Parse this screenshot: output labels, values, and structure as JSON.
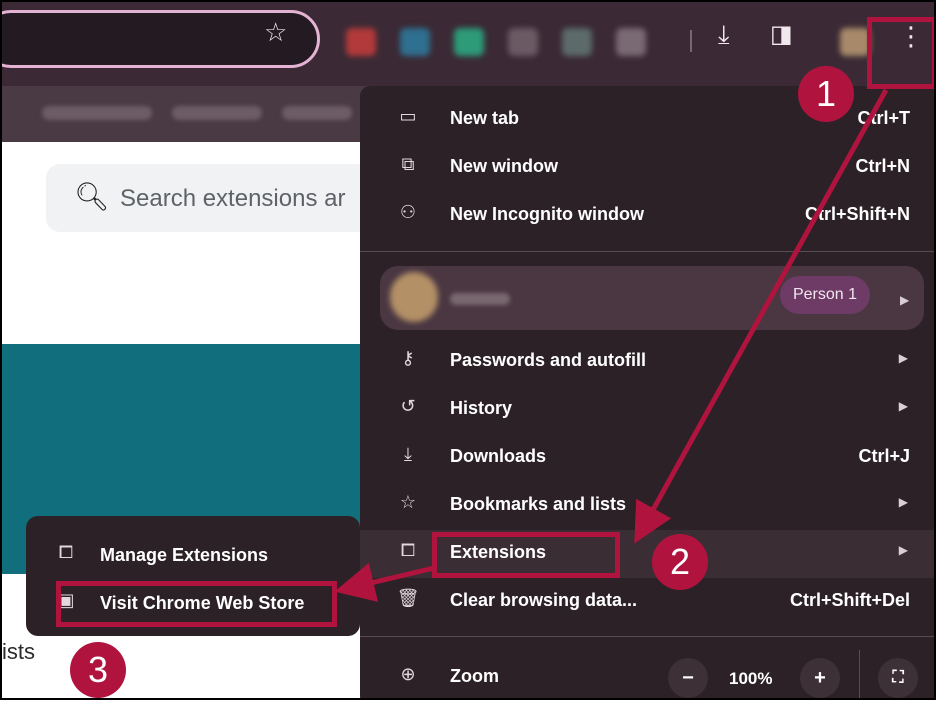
{
  "browser": {
    "toolbar_icons": [
      "star-icon",
      "download-icon",
      "side-panel-icon",
      "kebab-menu-icon"
    ]
  },
  "page": {
    "search": {
      "placeholder": "Search extensions ar"
    },
    "partial_text": "ists"
  },
  "menu": {
    "items": [
      {
        "icon": "new-tab-icon",
        "label": "New tab",
        "shortcut": "Ctrl+T"
      },
      {
        "icon": "new-window-icon",
        "label": "New window",
        "shortcut": "Ctrl+N"
      },
      {
        "icon": "incognito-icon",
        "label": "New Incognito window",
        "shortcut": "Ctrl+Shift+N"
      }
    ],
    "profile": {
      "badge": "Person 1"
    },
    "items2": [
      {
        "icon": "key-icon",
        "label": "Passwords and autofill",
        "shortcut": ""
      },
      {
        "icon": "history-icon",
        "label": "History",
        "shortcut": ""
      },
      {
        "icon": "download-icon",
        "label": "Downloads",
        "shortcut": "Ctrl+J"
      },
      {
        "icon": "star-icon",
        "label": "Bookmarks and lists",
        "shortcut": ""
      },
      {
        "icon": "puzzle-icon",
        "label": "Extensions",
        "shortcut": ""
      },
      {
        "icon": "trash-icon",
        "label": "Clear browsing data...",
        "shortcut": "Ctrl+Shift+Del"
      }
    ],
    "zoom": {
      "label": "Zoom",
      "value": "100%",
      "minus": "−",
      "plus": "+"
    }
  },
  "submenu": {
    "items": [
      {
        "icon": "puzzle-icon",
        "label": "Manage Extensions"
      },
      {
        "icon": "store-icon",
        "label": "Visit Chrome Web Store"
      }
    ]
  },
  "annotations": {
    "steps": [
      "1",
      "2",
      "3"
    ],
    "color": "#b0143e"
  }
}
